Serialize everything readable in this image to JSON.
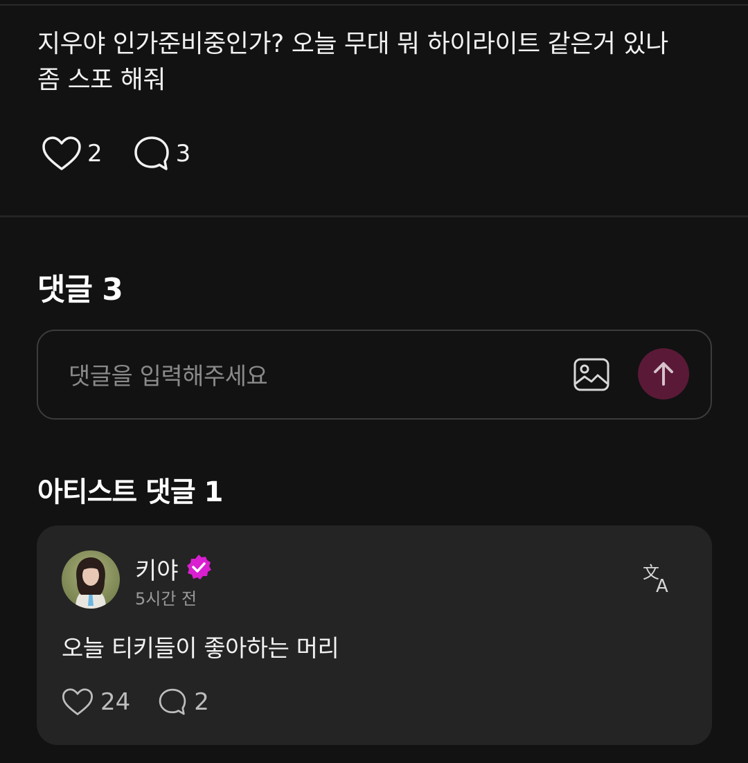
{
  "post": {
    "text_line1": "지우야 인가준비중인가? 오늘 무대 뭐 하이라이트 같은거 있나",
    "text_line2": "좀 스포 해줘",
    "like_count": "2",
    "comment_count": "3",
    "like_icon": "heart-outline-icon",
    "comment_icon": "speech-bubble-icon"
  },
  "comments": {
    "title": "댓글 3",
    "input_placeholder": "댓글을 입력해주세요",
    "image_icon": "image-icon",
    "send_icon": "arrow-up-icon",
    "send_button_color": "#5a1a37"
  },
  "artist_comments": {
    "title": "아티스트 댓글 1",
    "items": [
      {
        "author": "키야",
        "verified_color": "#d91fd0",
        "time": "5시간 전",
        "text": "오늘 티키들이 좋아하는 머리",
        "like_count": "24",
        "reply_count": "2",
        "translate_icon": "translate-icon"
      }
    ]
  }
}
